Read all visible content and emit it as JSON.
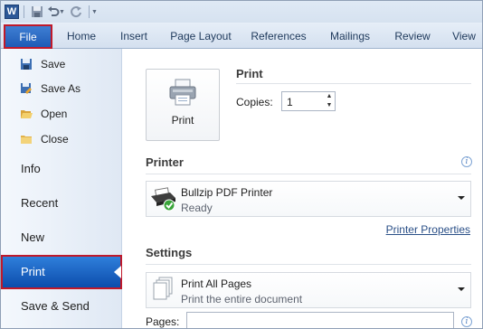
{
  "quick_access": {
    "app_icon": "W",
    "save_icon": "save-icon",
    "undo_icon": "undo-icon",
    "redo_icon": "redo-icon"
  },
  "ribbon": {
    "tabs": [
      {
        "label": "File"
      },
      {
        "label": "Home"
      },
      {
        "label": "Insert"
      },
      {
        "label": "Page Layout"
      },
      {
        "label": "References"
      },
      {
        "label": "Mailings"
      },
      {
        "label": "Review"
      },
      {
        "label": "View"
      }
    ]
  },
  "backstage": {
    "commands": [
      {
        "label": "Save",
        "icon": "save-icon"
      },
      {
        "label": "Save As",
        "icon": "save-as-icon"
      },
      {
        "label": "Open",
        "icon": "open-folder-icon"
      },
      {
        "label": "Close",
        "icon": "close-folder-icon"
      }
    ],
    "sections": [
      {
        "label": "Info"
      },
      {
        "label": "Recent"
      },
      {
        "label": "New"
      },
      {
        "label": "Print",
        "selected": true
      },
      {
        "label": "Save & Send"
      }
    ]
  },
  "print_panel": {
    "button_label": "Print",
    "heading": "Print",
    "copies_label": "Copies:",
    "copies_value": "1"
  },
  "printer_panel": {
    "heading": "Printer",
    "name": "Bullzip PDF Printer",
    "status": "Ready",
    "properties_link": "Printer Properties"
  },
  "settings_panel": {
    "heading": "Settings",
    "pages_option": "Print All Pages",
    "pages_option_desc": "Print the entire document",
    "pages_label": "Pages:",
    "pages_value": ""
  },
  "colors": {
    "accent_blue": "#1f5bb6",
    "highlight_red": "#c0192a"
  }
}
